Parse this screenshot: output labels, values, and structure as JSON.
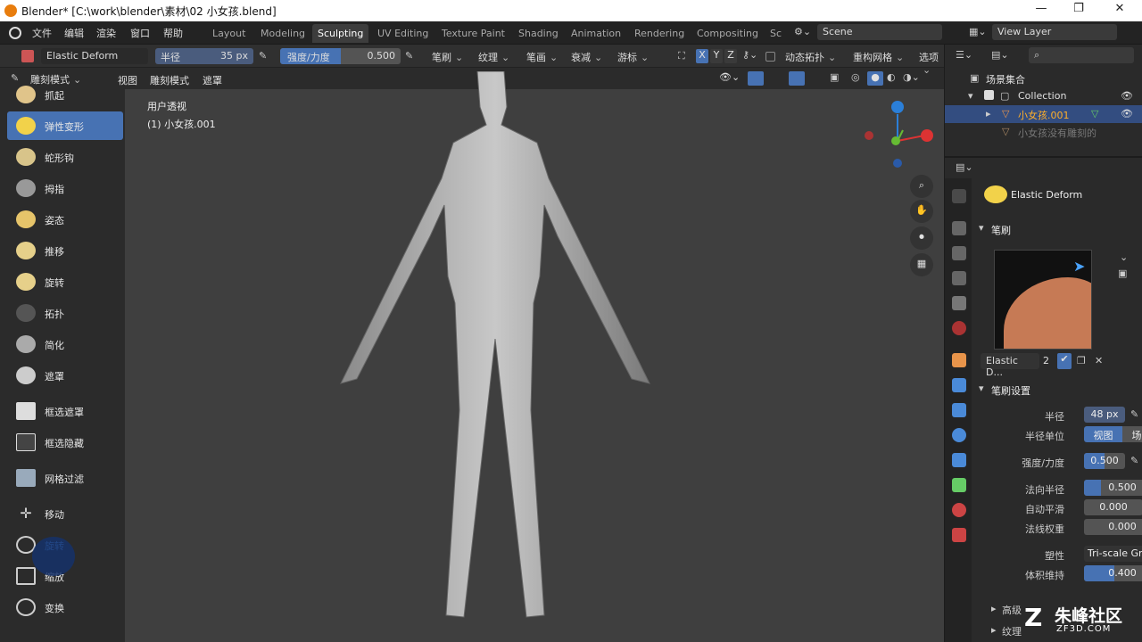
{
  "window": {
    "title": "Blender* [C:\\work\\blender\\素材\\02 小女孩.blend]"
  },
  "menu": [
    "文件",
    "编辑",
    "渲染",
    "窗口",
    "帮助"
  ],
  "workspaces": [
    {
      "label": "Layout"
    },
    {
      "label": "Modeling"
    },
    {
      "label": "Sculpting",
      "active": true
    },
    {
      "label": "UV Editing"
    },
    {
      "label": "Texture Paint"
    },
    {
      "label": "Shading"
    },
    {
      "label": "Animation"
    },
    {
      "label": "Rendering"
    },
    {
      "label": "Compositing"
    },
    {
      "label": "Sc"
    }
  ],
  "scene": "Scene",
  "view_layer": "View Layer",
  "toolheader": {
    "brush": "Elastic Deform",
    "radius_label": "半径",
    "radius_value": "35 px",
    "strength_label": "强度/力度",
    "strength_value": "0.500",
    "strength_fill": 0.5,
    "dropdowns": [
      "笔刷",
      "纹理",
      "笔画",
      "衰减",
      "游标"
    ],
    "axes": [
      "X",
      "Y",
      "Z"
    ],
    "dyntopo": "动态拓扑",
    "remesh": "重构网格",
    "options": "选项"
  },
  "viewheader": {
    "mode": "雕刻模式",
    "items": [
      "视图",
      "雕刻模式",
      "遮罩"
    ]
  },
  "viewport": {
    "line1": "用户透视",
    "line2": "(1) 小女孩.001"
  },
  "tools": [
    {
      "label": "抓起"
    },
    {
      "label": "弹性变形",
      "active": true
    },
    {
      "label": "蛇形钩"
    },
    {
      "label": "拇指"
    },
    {
      "label": "姿态"
    },
    {
      "label": "推移"
    },
    {
      "label": "旋转"
    },
    {
      "label": "拓扑"
    },
    {
      "label": "简化"
    },
    {
      "label": "遮罩"
    },
    {
      "label": "框选遮罩"
    },
    {
      "label": "框选隐藏"
    },
    {
      "label": "网格过滤"
    },
    {
      "label": "移动"
    },
    {
      "label": "旋转"
    },
    {
      "label": "缩放"
    },
    {
      "label": "变换"
    }
  ],
  "outliner": {
    "root": "场景集合",
    "collection": "Collection",
    "obj1": "小女孩.001",
    "obj2": "小女孩没有雕刻的"
  },
  "properties": {
    "brush_name": "Elastic Deform",
    "section_brush": "笔刷",
    "brush_slot": "Elastic D...",
    "brush_users": "2",
    "section_settings": "笔刷设置",
    "radius": {
      "label": "半径",
      "value": "48 px"
    },
    "radius_unit": {
      "label": "半径单位",
      "opt1": "视图",
      "opt2": "场景"
    },
    "strength": {
      "label": "强度/力度",
      "value": "0.500",
      "fill": 0.5
    },
    "normal_radius": {
      "label": "法向半径",
      "value": "0.500",
      "fill": 0.5
    },
    "autosmooth": {
      "label": "自动平滑",
      "value": "0.000"
    },
    "normal_weight": {
      "label": "法线权重",
      "value": "0.000"
    },
    "plasticity": {
      "label": "塑性",
      "value": "Tri-scale Gra"
    },
    "volume": {
      "label": "体积维持",
      "value": "0.400",
      "fill": 0.4
    },
    "adv": "高级",
    "tex": "纹理"
  },
  "watermark": {
    "name": "朱峰社区",
    "url": "ZF3D.COM"
  }
}
